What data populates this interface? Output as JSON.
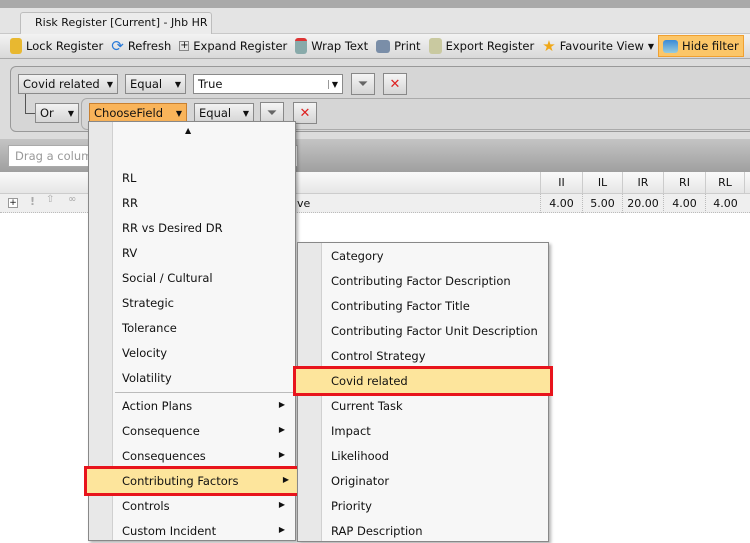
{
  "window": {
    "tab_title": "Risk Register [Current] - Jhb HR"
  },
  "toolbar": [
    {
      "label": "Lock Register",
      "icon": "lock-icon"
    },
    {
      "label": "Refresh",
      "icon": "refresh-icon"
    },
    {
      "label": "Expand Register",
      "icon": "expand-icon"
    },
    {
      "label": "Wrap Text",
      "icon": "wrap-text-icon"
    },
    {
      "label": "Print",
      "icon": "printer-icon"
    },
    {
      "label": "Export Register",
      "icon": "export-icon"
    },
    {
      "label": "Favourite View",
      "icon": "star-icon"
    },
    {
      "label": "Hide filter",
      "icon": "filter-panel-icon",
      "active": true
    }
  ],
  "filter": {
    "row1": {
      "field": "Covid related",
      "operator": "Equal",
      "value": "True"
    },
    "row2": {
      "logic": "Or",
      "field": "ChooseField",
      "operator": "Equal"
    }
  },
  "group_panel": {
    "placeholder": "Drag a column"
  },
  "grid": {
    "columns": [
      "II",
      "IL",
      "IR",
      "RI",
      "RL"
    ],
    "row": {
      "text_fragment": "ve",
      "values": [
        "4.00",
        "5.00",
        "20.00",
        "4.00",
        "4.00"
      ]
    }
  },
  "field_menu": {
    "fields": [
      "RL",
      "RR",
      "RR vs Desired DR",
      "RV",
      "Social / Cultural",
      "Strategic",
      "Tolerance",
      "Velocity",
      "Volatility"
    ],
    "groups": [
      "Action Plans",
      "Consequence",
      "Consequences",
      "Contributing Factors",
      "Controls",
      "Custom Incident"
    ],
    "highlighted": "Contributing Factors"
  },
  "submenu": {
    "items": [
      "Category",
      "Contributing Factor Description",
      "Contributing Factor Title",
      "Contributing Factor Unit Description",
      "Control Strategy",
      "Covid related",
      "Current Task",
      "Impact",
      "Likelihood",
      "Originator",
      "Priority",
      "RAP Description"
    ],
    "highlighted": "Covid related"
  },
  "colors": {
    "highlight": "#fde59c",
    "annotation": "#e8141c",
    "active_button": "#fcc668",
    "choose_field": "#f9b45a"
  }
}
